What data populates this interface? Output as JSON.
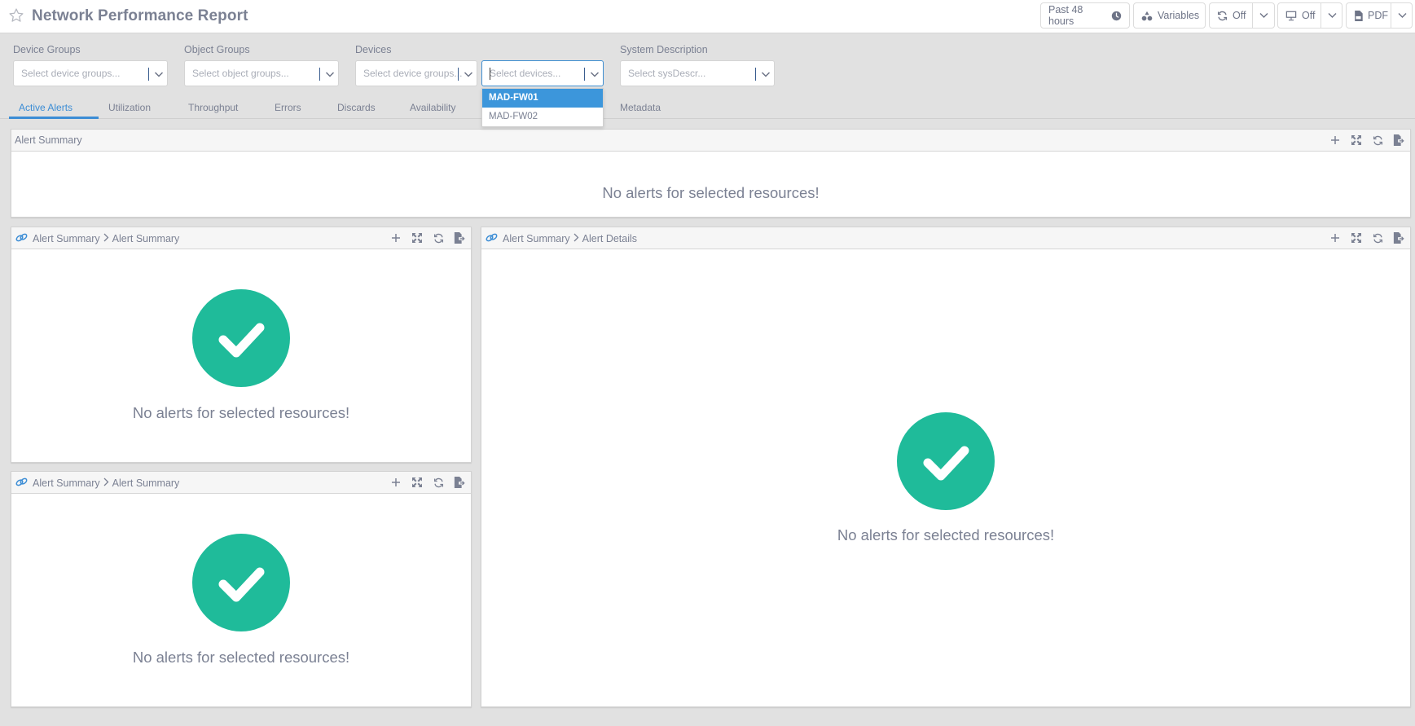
{
  "header": {
    "title": "Network Performance Report",
    "time_range": "Past 48 hours",
    "variables": "Variables",
    "refresh": "Off",
    "slideshow": "Off",
    "export": "PDF"
  },
  "filters": {
    "device_groups": {
      "label": "Device Groups",
      "placeholder": "Select device groups..."
    },
    "object_groups": {
      "label": "Object Groups",
      "placeholder": "Select object groups..."
    },
    "devices": {
      "label": "Devices",
      "group_placeholder": "Select device groups...",
      "device_placeholder": "Select devices..."
    },
    "system_description": {
      "label": "System Description",
      "placeholder": "Select sysDescr..."
    },
    "devices_dropdown": {
      "options": [
        "MAD-FW01",
        "MAD-FW02"
      ],
      "highlighted_index": 0
    }
  },
  "tabs": [
    {
      "label": "Active Alerts",
      "active": true
    },
    {
      "label": "Utilization",
      "active": false
    },
    {
      "label": "Throughput",
      "active": false
    },
    {
      "label": "Errors",
      "active": false
    },
    {
      "label": "Discards",
      "active": false
    },
    {
      "label": "Availability",
      "active": false
    },
    {
      "label": "Metadata",
      "active": false
    }
  ],
  "panels": {
    "summary": {
      "title": "Alert Summary",
      "message": "No alerts for selected resources!"
    },
    "left_top": {
      "crumb_parent": "Alert Summary",
      "crumb_child": "Alert Summary",
      "message": "No alerts for selected resources!"
    },
    "left_bottom": {
      "crumb_parent": "Alert Summary",
      "crumb_child": "Alert Summary",
      "message": "No alerts for selected resources!"
    },
    "right": {
      "crumb_parent": "Alert Summary",
      "crumb_child": "Alert Details",
      "message": "No alerts for selected resources!"
    }
  },
  "colors": {
    "accent": "#3c8dd5",
    "success": "#1fbb9a",
    "dropdown_highlight": "#3c96db",
    "background": "#e1e1e1"
  }
}
